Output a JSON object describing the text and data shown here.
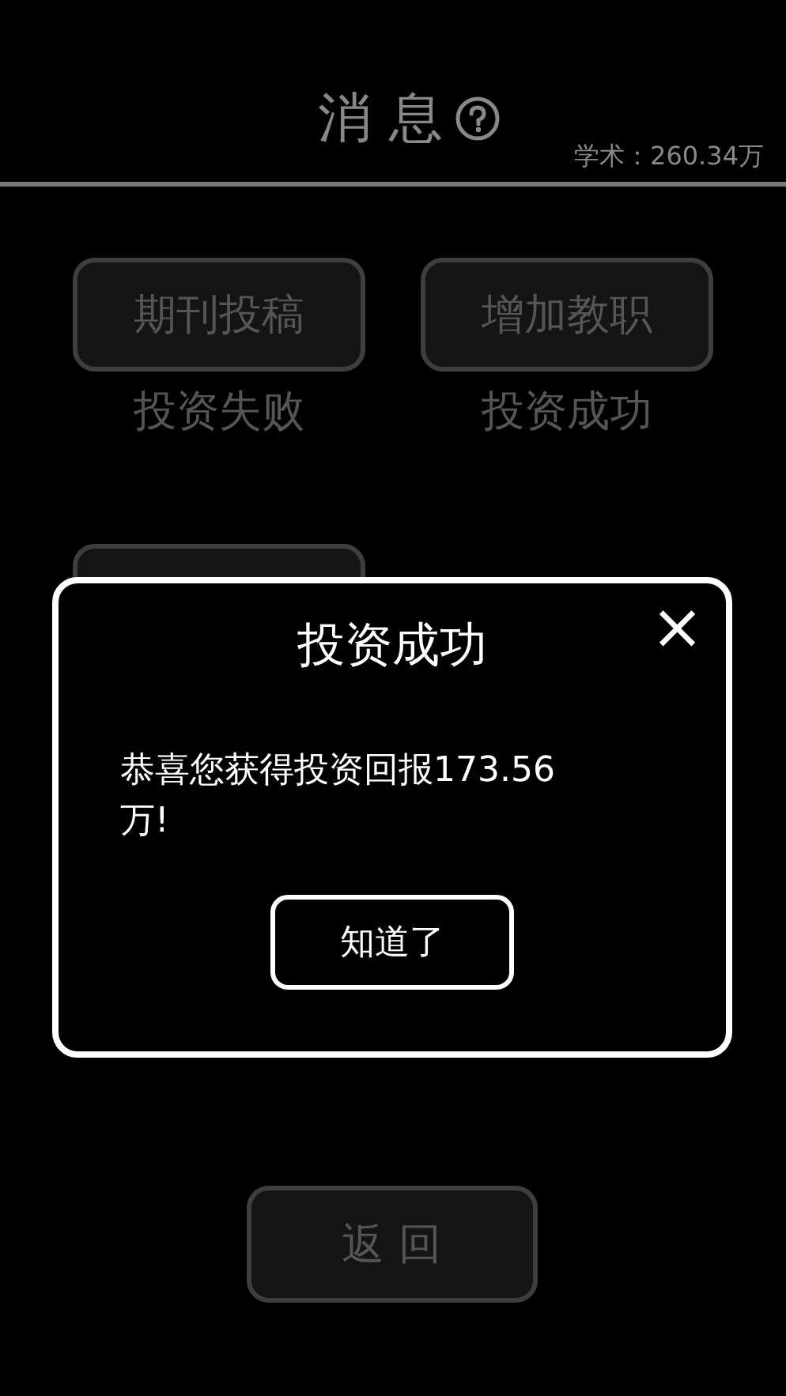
{
  "header": {
    "title": "消 息",
    "academic": "学术：260.34万"
  },
  "actions": [
    {
      "label": "期刊投稿",
      "result": "投资失败"
    },
    {
      "label": "增加教职",
      "result": "投资成功"
    }
  ],
  "dialog": {
    "title": "投资成功",
    "close": "×",
    "message": "恭喜您获得投资回报173.56万!",
    "confirm": "知道了"
  },
  "back_button": "返 回"
}
